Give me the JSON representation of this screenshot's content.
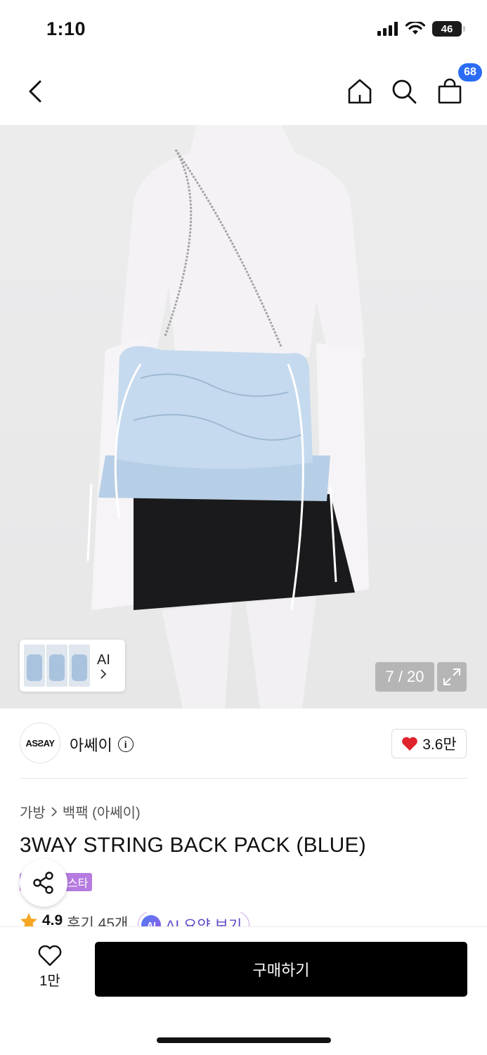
{
  "status_bar": {
    "time": "1:10",
    "battery": "46"
  },
  "header": {
    "cart_count": "68"
  },
  "gallery": {
    "counter": "7 / 20",
    "ai_label": "AI"
  },
  "brand": {
    "logo_text": "ASƧAY",
    "name": "아쎄이",
    "like_count": "3.6만"
  },
  "breadcrumb": {
    "category": "가방",
    "subcategory": "백팩 (아쎄이)"
  },
  "product": {
    "title": "3WAY STRING BACK PACK (BLUE)",
    "tag": "스타",
    "rating": "4.9",
    "reviews": "후기 45개",
    "ai_summary": "AI 요약 보기"
  },
  "bottom": {
    "wish_count": "1만",
    "buy_label": "구매하기"
  },
  "colors": {
    "accent_blue": "#2b6cf5",
    "heart_red": "#e0242c",
    "tag_purple": "#b57be0",
    "buy_black": "#000000"
  }
}
